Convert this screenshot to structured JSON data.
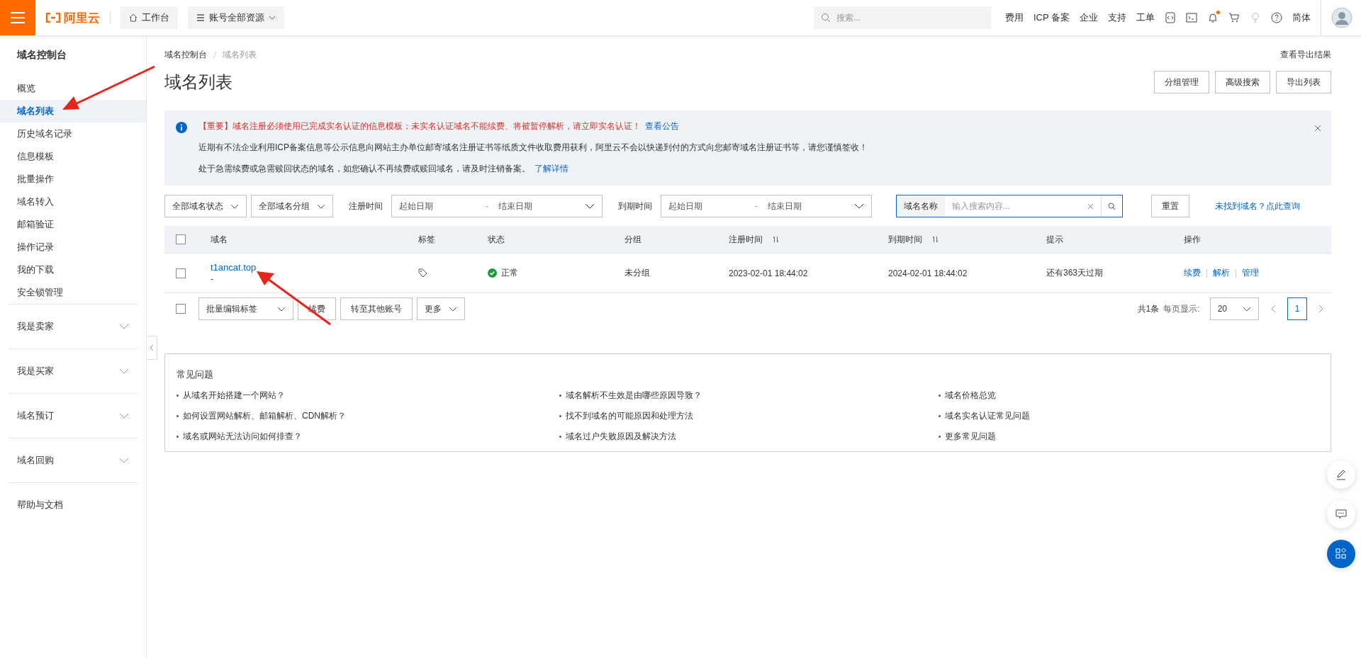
{
  "topbar": {
    "logo": "阿里云",
    "workbench": "工作台",
    "resource_scope": "账号全部资源",
    "search": {
      "placeholder": "搜索..."
    },
    "links": [
      "费用",
      "ICP 备案",
      "企业",
      "支持",
      "工单"
    ],
    "language": "简体"
  },
  "sidebar": {
    "title": "域名控制台",
    "items": [
      {
        "label": "概览",
        "selected": false
      },
      {
        "label": "域名列表",
        "selected": true
      },
      {
        "label": "历史域名记录",
        "selected": false
      },
      {
        "label": "信息模板",
        "selected": false
      },
      {
        "label": "批量操作",
        "selected": false
      },
      {
        "label": "域名转入",
        "selected": false
      },
      {
        "label": "邮箱验证",
        "selected": false
      },
      {
        "label": "操作记录",
        "selected": false
      },
      {
        "label": "我的下载",
        "selected": false
      },
      {
        "label": "安全锁管理",
        "selected": false
      }
    ],
    "groups": [
      {
        "label": "我是卖家",
        "expanded": false
      },
      {
        "label": "我是买家",
        "expanded": false
      },
      {
        "label": "域名预订",
        "expanded": false
      },
      {
        "label": "域名回购",
        "expanded": false
      }
    ],
    "help": "帮助与文档"
  },
  "breadcrumb": [
    "域名控制台",
    "域名列表"
  ],
  "export_results_link": "查看导出结果",
  "page_title": "域名列表",
  "header_buttons": [
    "分组管理",
    "高级搜索",
    "导出列表"
  ],
  "notice": {
    "lines": [
      {
        "kind": "important",
        "text": "【重要】域名注册必须使用已完成实名认证的信息模板；未实名认证域名不能续费、将被暂停解析，请立即实名认证！",
        "link": "查看公告"
      },
      {
        "kind": "normal",
        "text": "近期有不法企业利用ICP备案信息等公示信息向网站主办单位邮寄域名注册证书等纸质文件收取费用获利，阿里云不会以快递到付的方式向您邮寄域名注册证书等，请您谨慎签收！"
      },
      {
        "kind": "normal",
        "text": "处于急需续费或急需赎回状态的域名，如您确认不再续费或赎回域名，请及时注销备案。",
        "link": "了解详情"
      }
    ]
  },
  "filters": {
    "status_select": "全部域名状态",
    "group_select": "全部域名分组",
    "registration": {
      "label": "注册时间",
      "start_placeholder": "起始日期",
      "separator": "-",
      "end_placeholder": "结束日期"
    },
    "expiry": {
      "label": "到期时间",
      "start_placeholder": "起始日期",
      "separator": "-",
      "end_placeholder": "结束日期"
    },
    "search": {
      "field": "域名名称",
      "placeholder": "输入搜索内容..."
    },
    "reset": "重置",
    "not_found_link": "未找到域名？点此查询"
  },
  "table": {
    "header_checked": false,
    "columns": [
      {
        "label": "域名",
        "sortable": false
      },
      {
        "label": "标签",
        "sortable": false
      },
      {
        "label": "状态",
        "sortable": false
      },
      {
        "label": "分组",
        "sortable": false
      },
      {
        "label": "注册时间",
        "sortable": true
      },
      {
        "label": "到期时间",
        "sortable": true
      },
      {
        "label": "提示",
        "sortable": false
      },
      {
        "label": "操作",
        "sortable": false
      }
    ],
    "rows": [
      {
        "checked": false,
        "domain": "t1ancat.top",
        "sub": "-",
        "status": "正常",
        "status_ok": true,
        "group": "未分组",
        "registered": "2023-02-01 18:44:02",
        "expires": "2024-02-01 18:44:02",
        "hint": "还有363天过期",
        "actions": [
          "续费",
          "解析",
          "管理"
        ]
      }
    ]
  },
  "bottom_bar": {
    "checked": false,
    "batch_tags": "批量编辑标签",
    "buttons": [
      "续费",
      "转至其他账号"
    ],
    "more": "更多",
    "total": "共1条",
    "page_size_label": "每页显示:",
    "page_size": "20",
    "pages": [
      {
        "label": "1",
        "selected": true
      }
    ]
  },
  "faq": {
    "title": "常见问题",
    "items": [
      "从域名开始搭建一个网站？",
      "域名解析不生效是由哪些原因导致？",
      "域名价格总览",
      "如何设置网站解析、邮箱解析、CDN解析？",
      "找不到域名的可能原因和处理方法",
      "域名实名认证常见问题",
      "域名或网站无法访问如何排查？",
      "域名过户失败原因及解决方法",
      "更多常见问题"
    ]
  }
}
